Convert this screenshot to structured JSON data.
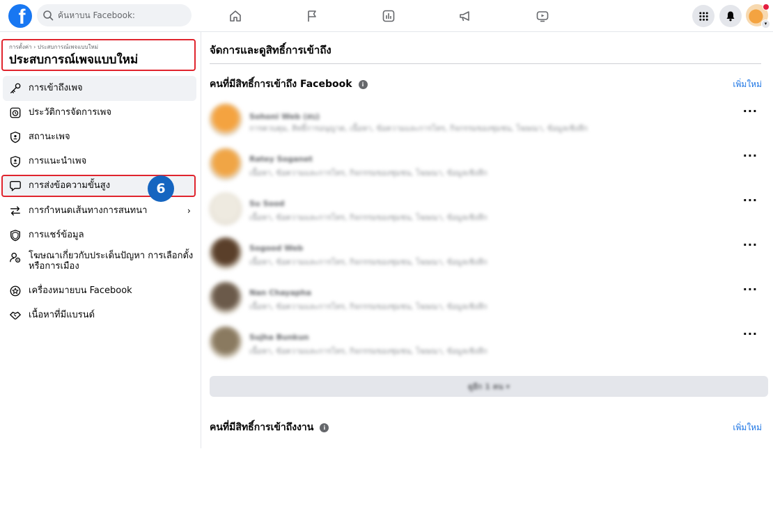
{
  "search": {
    "placeholder": "ค้นหาบน Facebook:"
  },
  "sidebar": {
    "breadcrumb": "การตั้งค่า › ประสบการณ์เพจแบบใหม่",
    "title": "ประสบการณ์เพจแบบใหม่",
    "items": [
      {
        "label": "การเข้าถึงเพจ",
        "icon": "key-icon"
      },
      {
        "label": "ประวัติการจัดการเพจ",
        "icon": "history-icon"
      },
      {
        "label": "สถานะเพจ",
        "icon": "shield-person-icon"
      },
      {
        "label": "การแนะนำเพจ",
        "icon": "shield-person-icon"
      },
      {
        "label": "การส่งข้อความขั้นสูง",
        "icon": "chat-bubble-icon"
      },
      {
        "label": "การกำหนดเส้นทางการสนทนา",
        "icon": "swap-arrows-icon"
      },
      {
        "label": "การแชร์ข้อมูล",
        "icon": "shield-icon"
      },
      {
        "label": "โฆษณาเกี่ยวกับประเด็นปัญหา การเลือกตั้ง หรือการเมือง",
        "label_line1": "โฆษณาเกี่ยวกับประเด็นปัญหา การเลือกตั้ง",
        "label_line2": "หรือการเมือง",
        "icon": "person-gear-icon"
      },
      {
        "label": "เครื่องหมายบน Facebook",
        "icon": "star-badge-icon"
      },
      {
        "label": "เนื้อหาที่มีแบรนด์",
        "icon": "handshake-icon"
      }
    ],
    "step_badge": "6"
  },
  "main": {
    "title": "จัดการและดูสิทธิ์การเข้าถึง",
    "section1": {
      "title": "คนที่มีสิทธิ์การเข้าถึง Facebook",
      "add_label": "เพิ่มใหม่",
      "people": [
        {
          "name": "Sohoni Web (ลบ)",
          "desc": "การควบคุม, สิทธิ์การอนุญาต, เนื้อหา, ข้อความและการโทร, กิจกรรมของชุมชน, โฆษณา, ข้อมูลเชิงลึก",
          "avatar_color": "#f4a340"
        },
        {
          "name": "Ratey Soganet",
          "desc": "เนื้อหา, ข้อความและการโทร, กิจกรรมของชุมชน, โฆษณา, ข้อมูลเชิงลึก",
          "avatar_color": "#f0a545"
        },
        {
          "name": "Su Sood",
          "desc": "เนื้อหา, ข้อความและการโทร, กิจกรรมของชุมชน, โฆษณา, ข้อมูลเชิงลึก",
          "avatar_color": "#eeeae0"
        },
        {
          "name": "Sogood Web",
          "desc": "เนื้อหา, ข้อความและการโทร, กิจกรรมของชุมชน, โฆษณา, ข้อมูลเชิงลึก",
          "avatar_color": "#5a3f2a"
        },
        {
          "name": "Nan Chayapha",
          "desc": "เนื้อหา, ข้อความและการโทร, กิจกรรมของชุมชน, โฆษณา, ข้อมูลเชิงลึก",
          "avatar_color": "#6b5a4a"
        },
        {
          "name": "Sujha Bunkun",
          "desc": "เนื้อหา, ข้อความและการโทร, กิจกรรมของชุมชน, โฆษณา, ข้อมูลเชิงลึก",
          "avatar_color": "#8a7a60"
        }
      ],
      "see_more": "ดูอีก 1 คน ▾"
    },
    "section2": {
      "title": "คนที่มีสิทธิ์การเข้าถึงงาน",
      "add_label": "เพิ่มใหม่"
    }
  },
  "colors": {
    "accent": "#1877f2",
    "highlight": "#e0242d",
    "badge": "#1565c0"
  }
}
